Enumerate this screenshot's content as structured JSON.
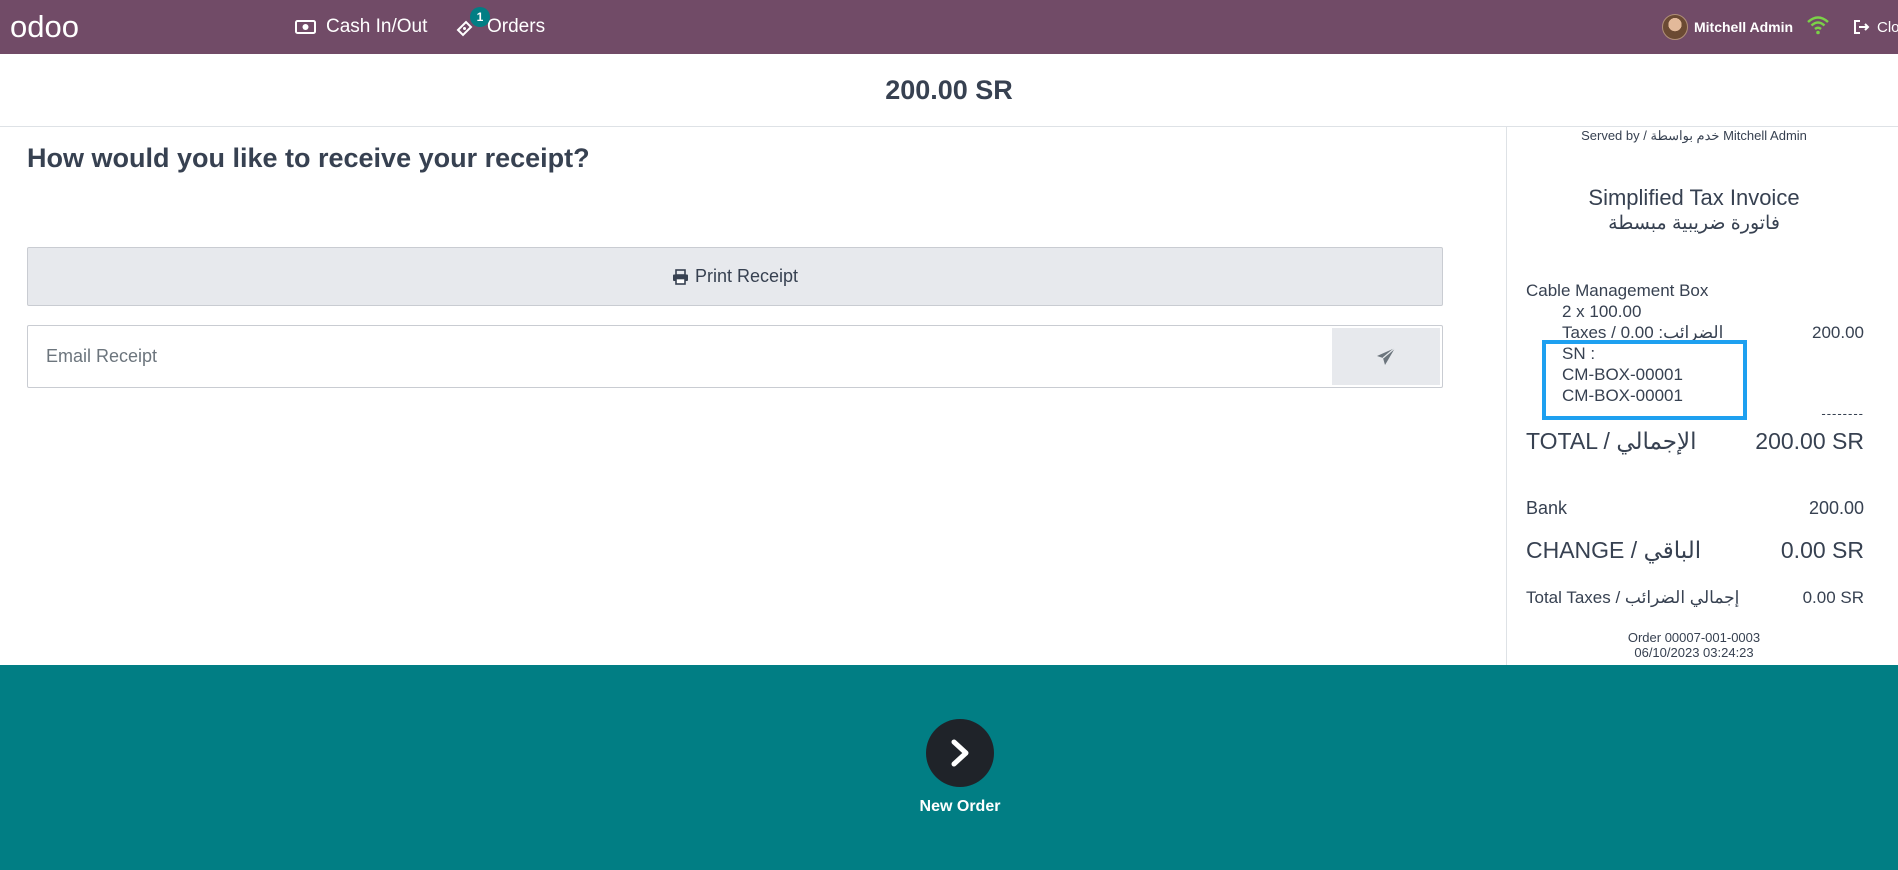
{
  "navbar": {
    "logo_text": "odoo",
    "cash_label": "Cash In/Out",
    "orders_label": "Orders",
    "orders_badge": "1",
    "user_name": "Mitchell Admin",
    "close_label": "Close"
  },
  "payment": {
    "amount": "200.00 SR"
  },
  "receipt_options": {
    "question": "How would you like to receive your receipt?",
    "print_label": "Print Receipt",
    "email_placeholder": "Email Receipt"
  },
  "receipt": {
    "served_by": "Served by / خدم بواسطة Mitchell Admin",
    "title": "Simplified Tax Invoice",
    "title_ar": "فاتورة ضريبية مبسطة",
    "lines": [
      {
        "product": "Cable Management Box",
        "qty_price": "2 x 100.00",
        "taxes": "Taxes / الضرائب: 0.00",
        "price": "200.00",
        "sn_label": "SN :",
        "serials": [
          "CM-BOX-00001",
          "CM-BOX-00001"
        ]
      }
    ],
    "separator": "--------",
    "total_label": "TOTAL / الإجمالي",
    "total_value": "200.00 SR",
    "payment_method": "Bank",
    "payment_value": "200.00",
    "change_label": "CHANGE / الباقي",
    "change_value": "0.00 SR",
    "total_taxes_label": "Total Taxes / إجمالي الضرائب",
    "total_taxes_value": "0.00 SR",
    "order_ref": "Order 00007-001-0003",
    "order_date": "06/10/2023 03:24:23"
  },
  "footer": {
    "next_label": "New Order"
  },
  "colors": {
    "navbar": "#714b67",
    "footer": "#017e84",
    "highlight": "#1ea0f0"
  }
}
